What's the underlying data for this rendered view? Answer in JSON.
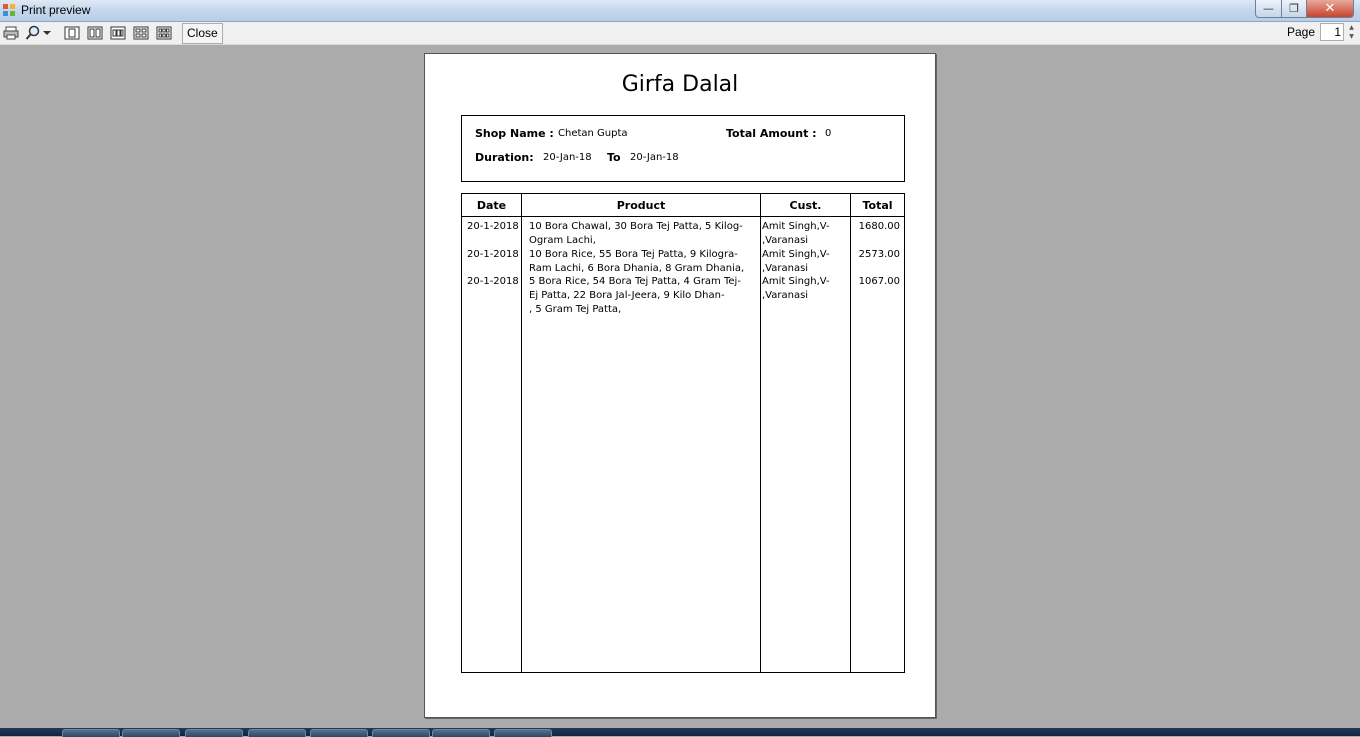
{
  "window": {
    "title": "Print preview",
    "min_glyph": "—",
    "max_glyph": "❐",
    "close_glyph": "✕"
  },
  "toolbar": {
    "close_label": "Close",
    "page_label": "Page",
    "page_value": "1",
    "icons": [
      "print-icon",
      "zoom-icon",
      "one-page-icon",
      "two-pages-icon",
      "three-pages-icon",
      "four-pages-icon",
      "six-pages-icon"
    ]
  },
  "report": {
    "title": "Girfa Dalal",
    "shop_name_label": "Shop Name :",
    "shop_name_value": "Chetan Gupta",
    "total_amount_label": "Total Amount :",
    "total_amount_value": "0",
    "duration_label": "Duration:",
    "duration_from": "20-Jan-18",
    "to_label": "To",
    "duration_to": "20-Jan-18",
    "columns": [
      "Date",
      "Product",
      "Cust.",
      "Total"
    ],
    "rows": [
      {
        "date": "20-1-2018",
        "product": "10 Bora Chawal, 30 Bora Tej Patta, 5 Kilog-\nOgram Lachi,",
        "cust": "Amit Singh,V-\n,Varanasi",
        "total": "1680.00"
      },
      {
        "date": "20-1-2018",
        "product": "10 Bora Rice, 55 Bora Tej Patta, 9 Kilogra-\nRam Lachi, 6 Bora Dhania, 8 Gram Dhania,",
        "cust": "Amit Singh,V-\n,Varanasi",
        "total": "2573.00"
      },
      {
        "date": "20-1-2018",
        "product": "5 Bora Rice, 54 Bora Tej Patta, 4 Gram Tej-\nEj Patta, 22 Bora Jal-Jeera, 9 Kilo Dhan-\n, 5 Gram Tej Patta,",
        "cust": "Amit Singh,V-\n,Varanasi",
        "total": "1067.00"
      }
    ]
  }
}
